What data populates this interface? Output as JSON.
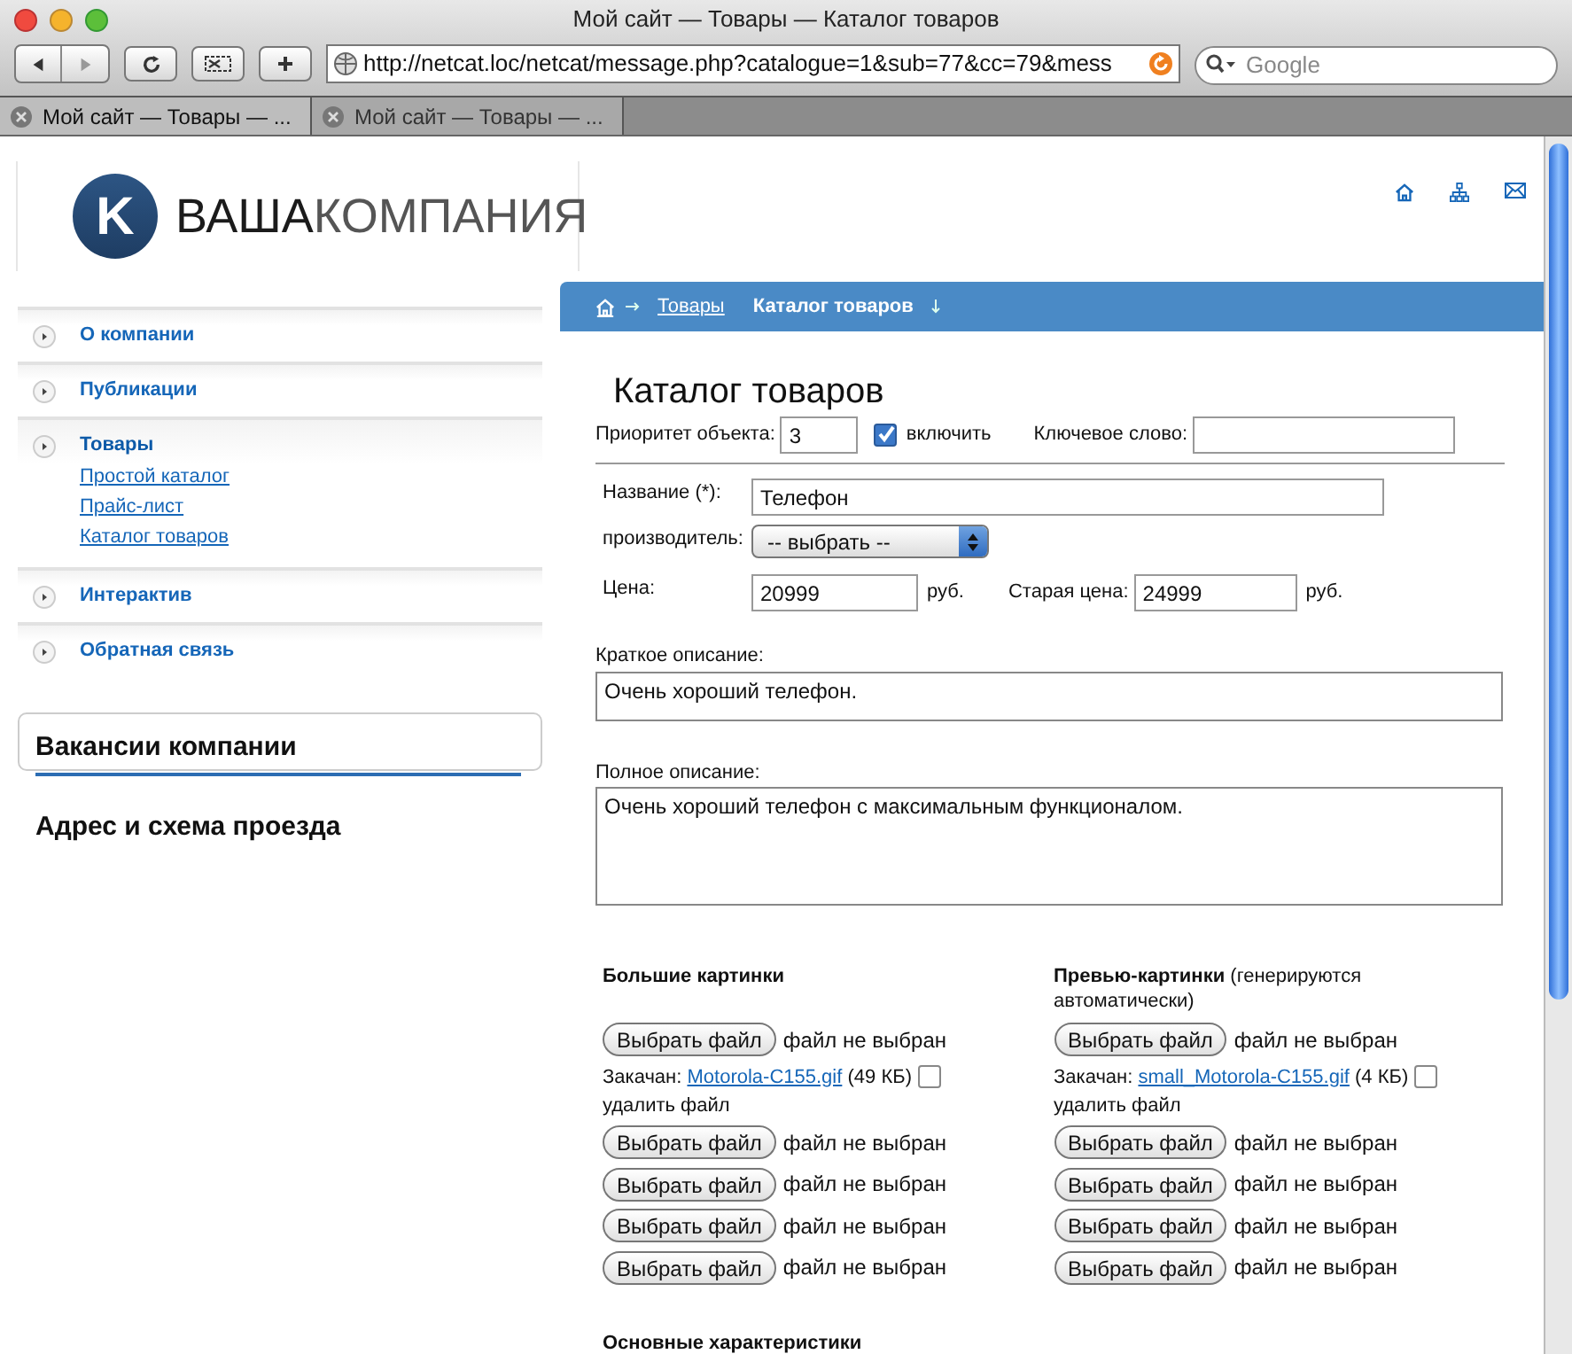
{
  "browser": {
    "title": "Мой сайт — Товары — Каталог товаров",
    "url": "http://netcat.loc/netcat/message.php?catalogue=1&sub=77&cc=79&mess",
    "search": {
      "placeholder": "Google"
    },
    "tabs": [
      {
        "label": "Мой сайт — Товары — ...",
        "selected": true
      },
      {
        "label": "Мой сайт — Товары — ...",
        "selected": false
      }
    ]
  },
  "header": {
    "logo": {
      "letter": "K",
      "words": [
        "ВАША",
        "КОМПАНИЯ"
      ]
    }
  },
  "sidebar": {
    "menu": [
      {
        "label": "О компании",
        "expanded": false
      },
      {
        "label": "Публикации",
        "expanded": false
      },
      {
        "label": "Товары",
        "expanded": true,
        "children": [
          {
            "label": "Простой каталог"
          },
          {
            "label": "Прайс-лист"
          },
          {
            "label": "Каталог товаров"
          }
        ]
      },
      {
        "label": "Интерактив",
        "expanded": false
      },
      {
        "label": "Обратная связь",
        "expanded": false
      }
    ],
    "widgets": [
      {
        "kind": "box",
        "title": "Вакансии компании"
      },
      {
        "kind": "plain",
        "title": "Адрес и схема проезда"
      }
    ]
  },
  "breadcrumb": {
    "items": [
      {
        "kind": "link",
        "label": "Товары"
      },
      {
        "kind": "current",
        "label": "Каталог товаров"
      }
    ]
  },
  "form": {
    "title": "Каталог товаров",
    "priority": {
      "label": "Приоритет объекта:",
      "value": "3"
    },
    "enable": {
      "label": "включить",
      "checked": true
    },
    "keyword": {
      "label": "Ключевое слово:"
    },
    "name": {
      "label": "Название (*):",
      "value": "Телефон"
    },
    "manufacturer": {
      "label": "производитель:",
      "value": "-- выбрать --"
    },
    "price": {
      "label": "Цена:",
      "value": "20999",
      "unit": "руб."
    },
    "old_price": {
      "label": "Старая цена:",
      "value": "24999",
      "unit": "руб."
    },
    "short_description": {
      "label": "Краткое описание:",
      "value": "Очень хороший телефон."
    },
    "full_description": {
      "label": "Полное описание:",
      "value": "Очень хороший телефон с максимальным функционалом."
    },
    "image_columns": [
      {
        "title": "Большие картинки",
        "files": [
          {
            "kind": "chooser",
            "button": "Выбрать файл",
            "status": "файл не выбран"
          },
          {
            "kind": "uploaded",
            "label": "Закачан:",
            "link": "Motorola-C155.gif",
            "size": "(49 КБ)",
            "delete_label": "удалить файл",
            "checked": false
          },
          {
            "kind": "chooser",
            "button": "Выбрать файл",
            "status": "файл не выбран"
          },
          {
            "kind": "chooser",
            "button": "Выбрать файл",
            "status": "файл не выбран"
          },
          {
            "kind": "chooser",
            "button": "Выбрать файл",
            "status": "файл не выбран"
          },
          {
            "kind": "chooser",
            "button": "Выбрать файл",
            "status": "файл не выбран"
          }
        ]
      },
      {
        "title": "Превью-картинки",
        "note": "(генерируются автоматически)",
        "files": [
          {
            "kind": "chooser",
            "button": "Выбрать файл",
            "status": "файл не выбран"
          },
          {
            "kind": "uploaded",
            "label": "Закачан:",
            "link": "small_Motorola-C155.gif",
            "size": "(4 КБ)",
            "delete_label": "удалить файл",
            "checked": false
          },
          {
            "kind": "chooser",
            "button": "Выбрать файл",
            "status": "файл не выбран"
          },
          {
            "kind": "chooser",
            "button": "Выбрать файл",
            "status": "файл не выбран"
          },
          {
            "kind": "chooser",
            "button": "Выбрать файл",
            "status": "файл не выбран"
          },
          {
            "kind": "chooser",
            "button": "Выбрать файл",
            "status": "файл не выбран"
          }
        ]
      }
    ],
    "next_section": "Основные характеристики"
  }
}
